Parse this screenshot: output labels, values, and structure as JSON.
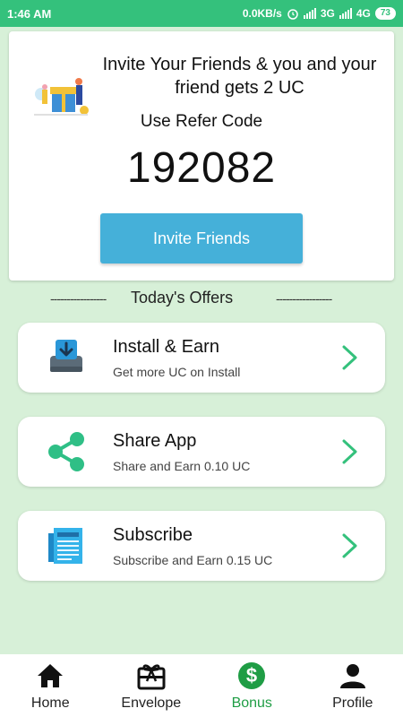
{
  "status_bar": {
    "time": "1:46 AM",
    "speed": "0.0KB/s",
    "network_3g": "3G",
    "network_4g": "4G",
    "battery": "73"
  },
  "refer_card": {
    "invite_text": "Invite Your Friends & you and your friend gets 2 UC",
    "refer_label": "Use Refer Code",
    "refer_code": "192082",
    "invite_button": "Invite Friends"
  },
  "offers": {
    "dashes_left": "-----------------",
    "title": "Today's Offers",
    "dashes_right": "-----------------",
    "items": [
      {
        "title": "Install & Earn",
        "subtitle": "Get more UC on Install",
        "icon": "download-icon"
      },
      {
        "title": "Share App",
        "subtitle": "Share and Earn 0.10 UC",
        "icon": "share-icon"
      },
      {
        "title": "Subscribe",
        "subtitle": "Subscribe and Earn 0.15 UC",
        "icon": "newspaper-icon"
      }
    ]
  },
  "bottom_nav": {
    "active": "Bonus",
    "accent": "#1f9d45",
    "items": [
      {
        "label": "Home",
        "icon": "home-icon"
      },
      {
        "label": "Envelope",
        "icon": "gift-card-icon"
      },
      {
        "label": "Bonus",
        "icon": "dollar-icon"
      },
      {
        "label": "Profile",
        "icon": "person-icon"
      }
    ]
  },
  "colors": {
    "status_bar": "#34c17c",
    "background": "#d7f0d8",
    "invite_button": "#45b0d9",
    "chevron": "#34c17c"
  }
}
